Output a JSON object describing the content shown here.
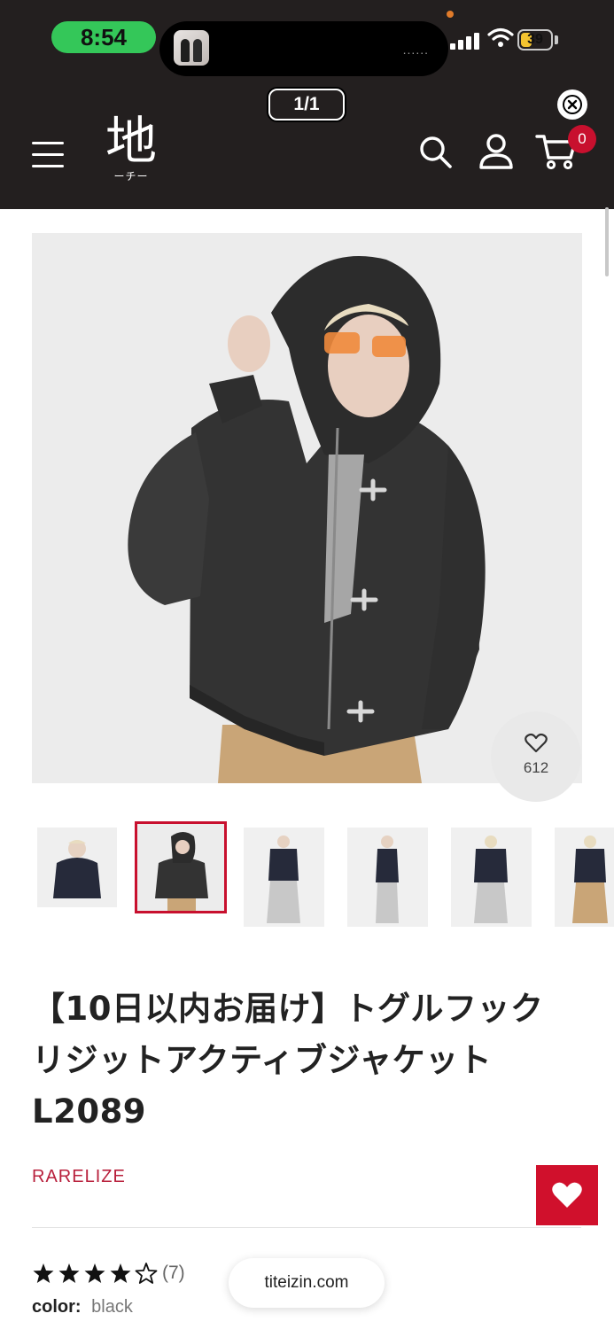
{
  "status_bar": {
    "time": "8:54",
    "battery": "39",
    "island_dots": "......"
  },
  "header": {
    "page_indicator": "1/1",
    "logo_char": "地",
    "logo_sub": "ーチー",
    "cart_count": "0"
  },
  "product": {
    "favorites_count": "612",
    "title_lines": [
      "【10日以内お届け】トグルフック",
      "リジットアクティブジャケット",
      "L2089"
    ],
    "brand": "RARELIZE",
    "rating": 4,
    "rating_max": 5,
    "review_count": "(7)",
    "color_label": "color:",
    "color_value": "black",
    "thumbnails": [
      "front-hood-down",
      "front-hood-up",
      "full-body-front",
      "full-body-side",
      "full-body-back",
      "full-body-alt"
    ],
    "selected_thumbnail": 1
  },
  "browser": {
    "url": "titeizin.com"
  },
  "colors": {
    "header_bg": "#231f1f",
    "accent": "#c8102e",
    "brand_text": "#b8203c",
    "status_pill": "#34c759"
  }
}
